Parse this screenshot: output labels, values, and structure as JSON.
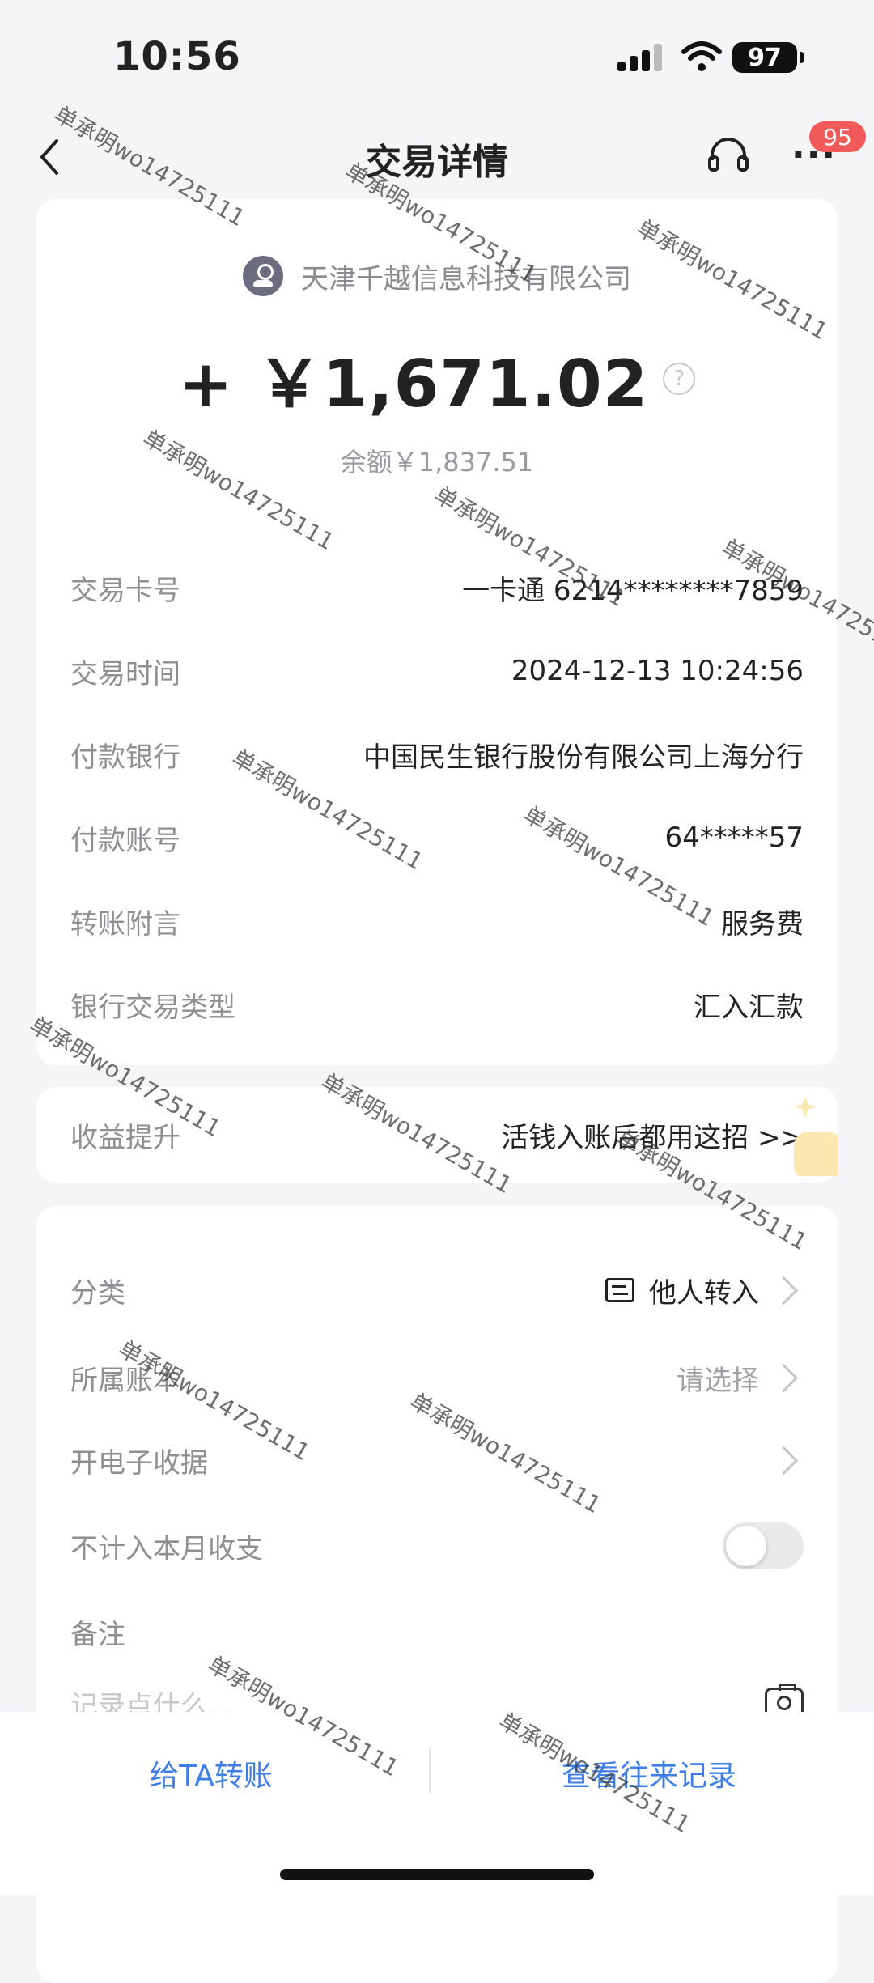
{
  "status": {
    "time": "10:56",
    "battery": "97"
  },
  "nav": {
    "title": "交易详情",
    "badge": "95",
    "more": "···"
  },
  "transaction": {
    "payer": "天津千越信息科技有限公司",
    "amount": "+ ￥1,671.02",
    "help": "?",
    "balance": "余额￥1,837.51",
    "details": [
      {
        "label": "交易卡号",
        "value": "一卡通 6214********7859"
      },
      {
        "label": "交易时间",
        "value": "2024-12-13 10:24:56"
      },
      {
        "label": "付款银行",
        "value": "中国民生银行股份有限公司上海分行"
      },
      {
        "label": "付款账号",
        "value": "64*****57"
      },
      {
        "label": "转账附言",
        "value": "服务费"
      },
      {
        "label": "银行交易类型",
        "value": "汇入汇款"
      }
    ]
  },
  "promo": {
    "label": "收益提升",
    "value": "活钱入账后都用这招 >>"
  },
  "settings": {
    "category_label": "分类",
    "category_value": "他人转入",
    "account_label": "所属账本",
    "account_value": "请选择",
    "receipt_label": "开电子收据",
    "exclude_label": "不计入本月收支",
    "note_label": "备注",
    "note_placeholder": "记录点什么..."
  },
  "bottom": {
    "transfer": "给TA转账",
    "history": "查看往来记录"
  },
  "watermark": "单承明wo14725111"
}
